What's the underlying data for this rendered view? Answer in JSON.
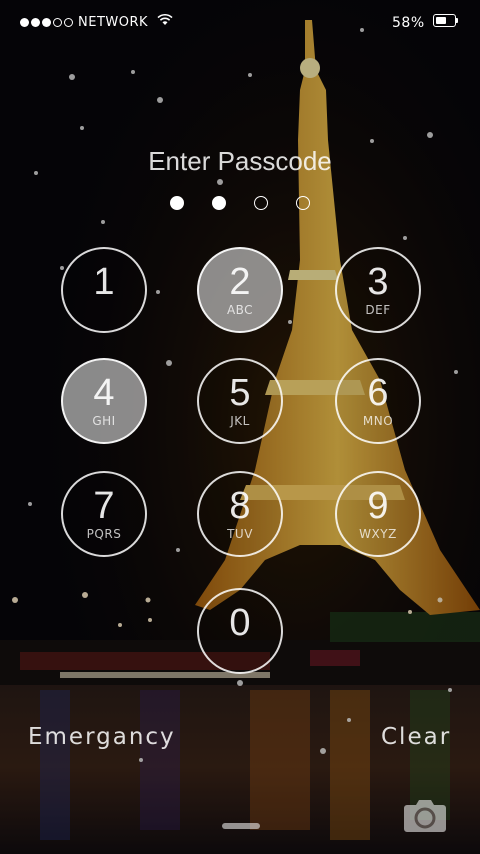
{
  "status_bar": {
    "signal_strength": 3,
    "signal_max": 5,
    "carrier": "NETWORK",
    "battery_text": "58%",
    "battery_level": 0.58
  },
  "lock_screen": {
    "title": "Enter Passcode",
    "entered_digits": 2,
    "passcode_length": 4,
    "pressed_key": "4",
    "keys": [
      {
        "num": "1",
        "letters": ""
      },
      {
        "num": "2",
        "letters": "ABC"
      },
      {
        "num": "3",
        "letters": "DEF"
      },
      {
        "num": "4",
        "letters": "GHI"
      },
      {
        "num": "5",
        "letters": "JKL"
      },
      {
        "num": "6",
        "letters": "MNO"
      },
      {
        "num": "7",
        "letters": "PQRS"
      },
      {
        "num": "8",
        "letters": "TUV"
      },
      {
        "num": "9",
        "letters": "WXYZ"
      },
      {
        "num": "0",
        "letters": ""
      }
    ],
    "emergency_label": "Emergancy",
    "clear_label": "Clear",
    "icons": [
      "wifi-icon",
      "battery-icon",
      "camera-icon"
    ]
  }
}
